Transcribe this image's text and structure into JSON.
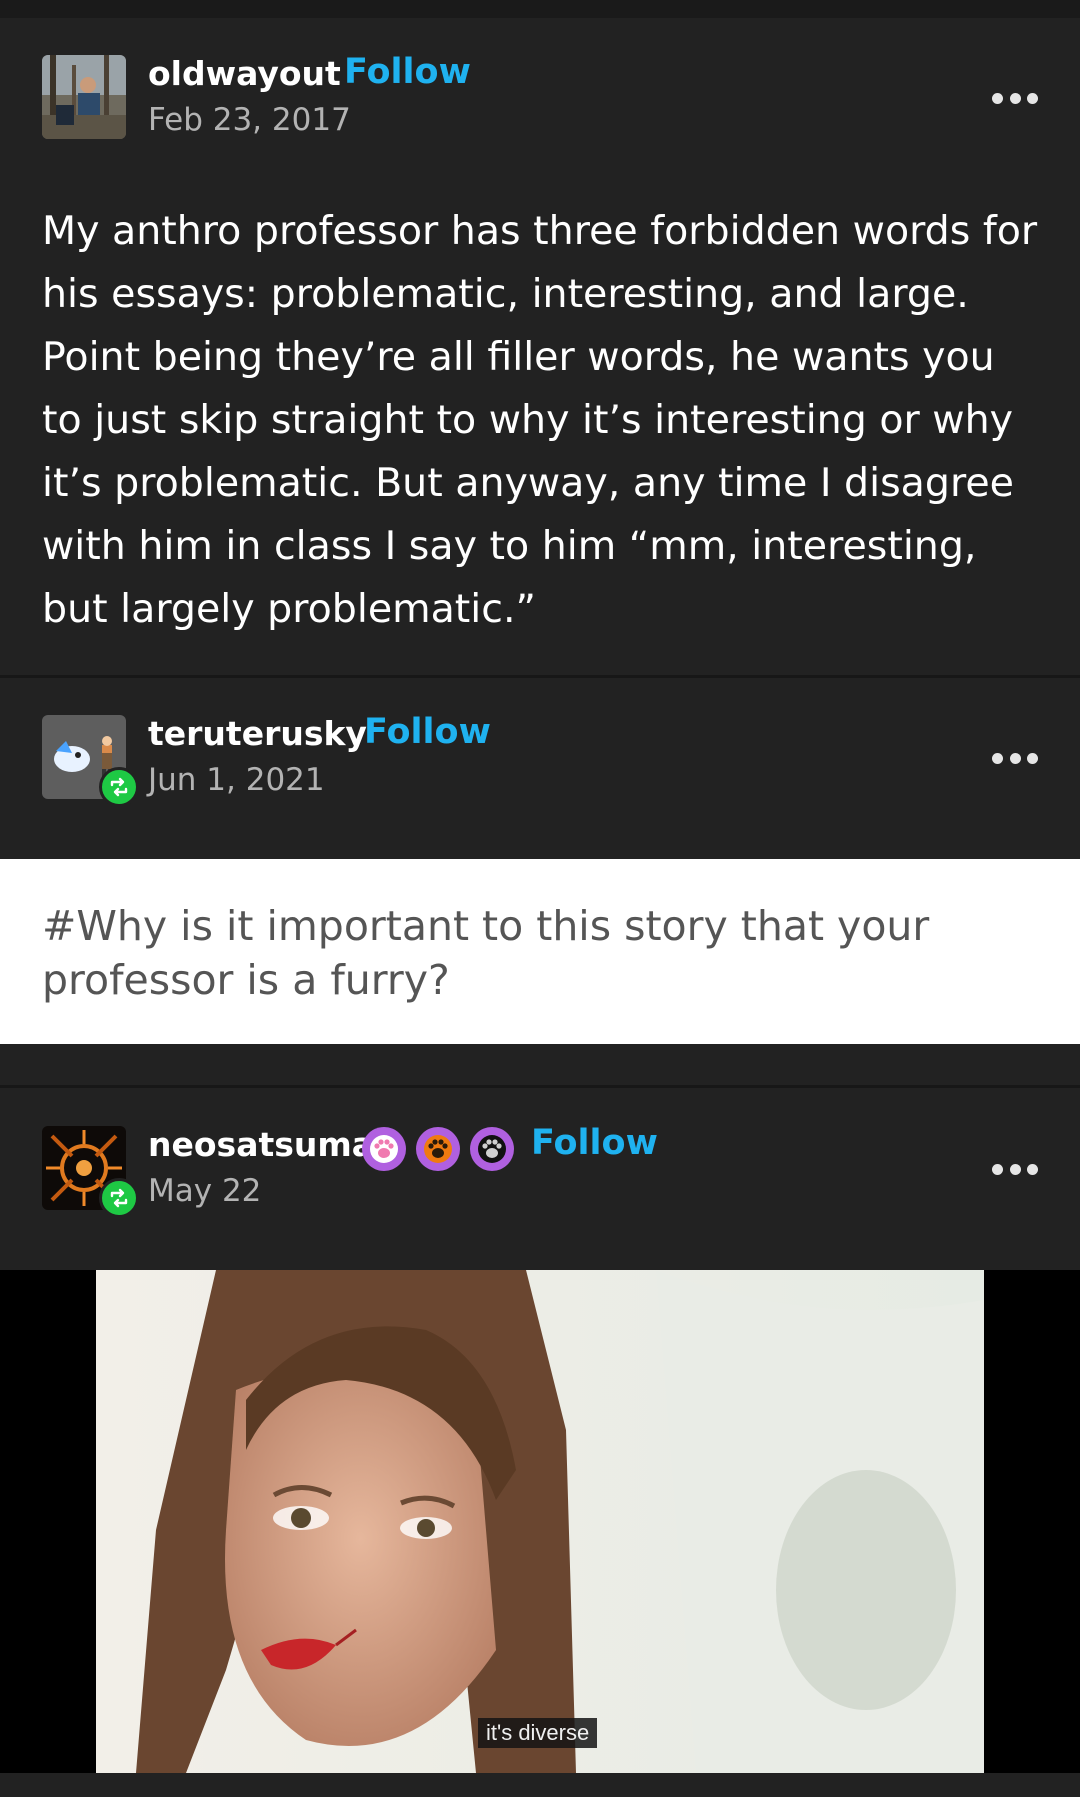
{
  "posts": [
    {
      "username": "oldwayout",
      "follow_label": "Follow",
      "date": "Feb 23, 2017",
      "body": "My anthro professor has three forbidden words for his essays: problematic, interesting, and large. Point being they’re all filler words, he wants you to just skip straight to why it’s interesting or why it’s problematic. But anyway, any time I disagree with him in class I say to him “mm, interesting, but largely problematic.”",
      "more_icon": "more-icon"
    },
    {
      "username": "teruterusky",
      "follow_label": "Follow",
      "date": "Jun 1, 2021",
      "badge_icon": "reblog-icon",
      "tag": "#Why is it important to this story that your professor is a furry?",
      "more_icon": "more-icon"
    },
    {
      "username": "neosatsuma",
      "follow_label": "Follow",
      "date": "May 22",
      "badge_icon": "reblog-icon",
      "user_badges": [
        "paw-badge-pink",
        "paw-badge-orange",
        "paw-badge-black"
      ],
      "more_icon": "more-icon",
      "media_caption": "it's diverse"
    }
  ],
  "colors": {
    "background": "#222222",
    "follow": "#1fb2f0",
    "reblog": "#1ec944",
    "date": "#b3b3b3"
  }
}
